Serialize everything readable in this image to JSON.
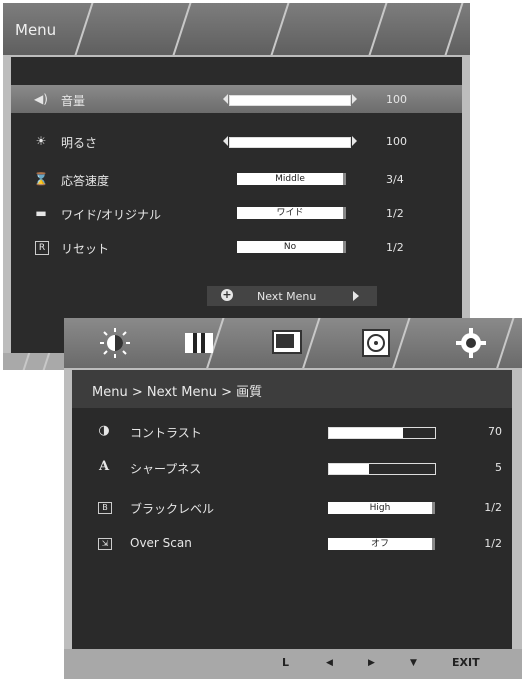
{
  "menu1": {
    "title": "Menu",
    "rows": [
      {
        "icon": "speaker-icon",
        "glyph": "◀)",
        "label": "音量",
        "value": "100",
        "level_percent": 100
      },
      {
        "icon": "sun-icon",
        "glyph": "☀",
        "label": "明るさ",
        "value": "100",
        "level_percent": 100
      },
      {
        "icon": "hourglass-icon",
        "glyph": "⌛",
        "label": "応答速度",
        "option": "Middle",
        "value": "3/4"
      },
      {
        "icon": "aspect-icon",
        "glyph": "▬",
        "label": "ワイド/オリジナル",
        "option": "ワイド",
        "value": "1/2"
      },
      {
        "icon": "reset-icon",
        "glyph": "R",
        "label": "リセット",
        "option": "No",
        "value": "1/2"
      }
    ],
    "next_menu": "Next Menu"
  },
  "menu2": {
    "tabs": [
      "brightness-contrast-icon",
      "picture-mode-icon",
      "color-icon",
      "disc-icon",
      "gear-icon"
    ],
    "breadcrumb": "Menu > Next Menu > 画質",
    "rows": [
      {
        "icon": "contrast-icon",
        "glyph": "◑",
        "label": "コントラスト",
        "value": "70",
        "level_percent": 70
      },
      {
        "icon": "sharpness-icon",
        "glyph": "A",
        "label": "シャープネス",
        "value": "5",
        "level_percent": 38
      },
      {
        "icon": "black-level-icon",
        "glyph": "B",
        "label": "ブラックレベル",
        "option": "High",
        "value": "1/2"
      },
      {
        "icon": "overscan-icon",
        "glyph": "⇲",
        "label": "Over Scan",
        "option": "オフ",
        "value": "1/2"
      }
    ],
    "footer": {
      "back": "L",
      "left": "◀",
      "right": "▶",
      "down": "▼",
      "exit": "EXIT"
    }
  },
  "colors": {
    "panel_dark": "#2b2b2b",
    "chrome": "#bdbdbd"
  }
}
